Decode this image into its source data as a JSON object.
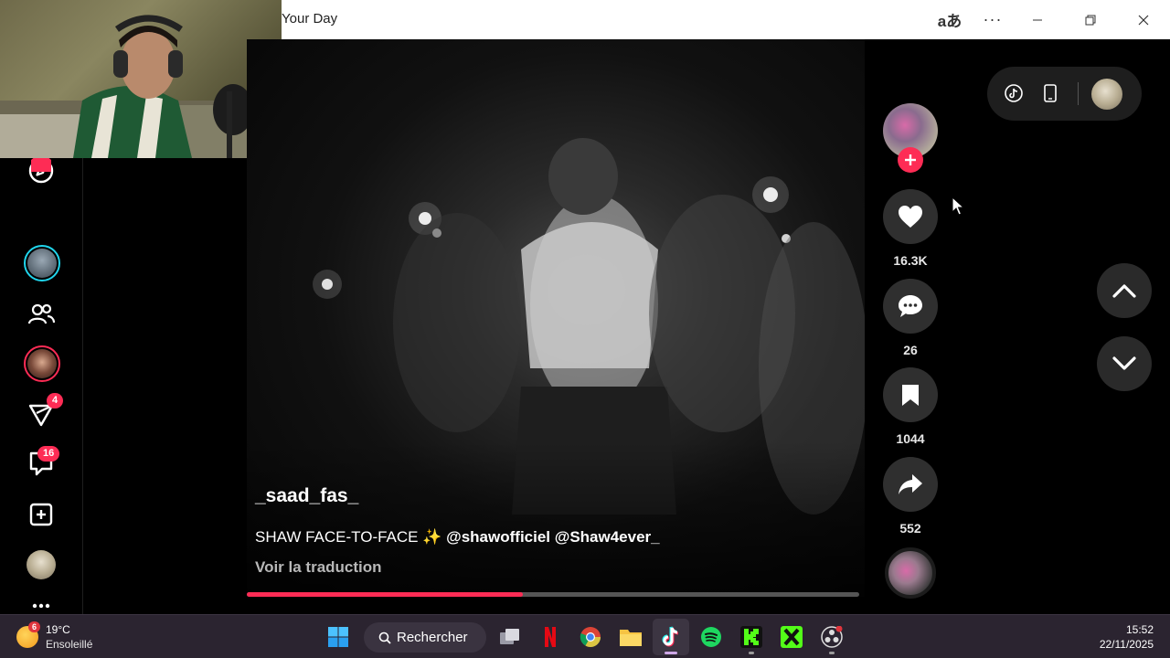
{
  "window": {
    "title": "Your Day",
    "translate_glyph": "aあ",
    "more_glyph": "···"
  },
  "sidebar": {
    "badges": {
      "inbox": "4",
      "messages": "16"
    }
  },
  "video": {
    "author": "_saad_fas_",
    "caption_text": "SHAW FACE-TO-FACE ✨ ",
    "caption_mentions": "@shawofficiel @Shaw4ever_",
    "translate_link": "Voir la traduction",
    "progress_percent": 45
  },
  "actions": {
    "likes": "16.3K",
    "comments": "26",
    "saves": "1044",
    "shares": "552"
  },
  "taskbar": {
    "weather_badge": "6",
    "temperature": "19°C",
    "condition": "Ensoleillé",
    "search_label": "Rechercher",
    "time": "15:52",
    "date": "22/11/2025"
  },
  "colors": {
    "accent": "#fe2c55",
    "live_ring": "#20d5ec"
  }
}
